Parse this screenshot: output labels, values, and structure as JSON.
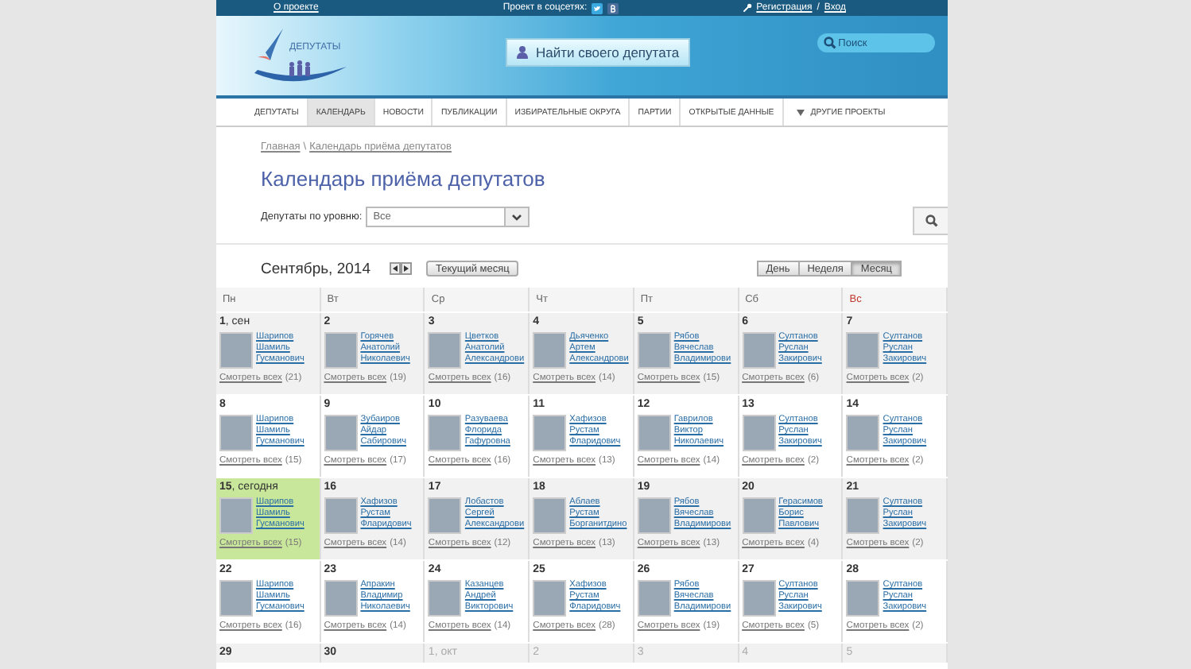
{
  "top_bar": {
    "about_link": "О проекте",
    "social_label": "Проект в соцсетях:",
    "register_link": "Регистрация",
    "separator": "/",
    "login_link": "Вход"
  },
  "header": {
    "logo_text": "ДЕПУТАТЫ",
    "find_button": "Найти своего депутата",
    "search": {
      "placeholder": "Поиск"
    }
  },
  "nav": [
    {
      "label": "ДЕПУТАТЫ",
      "selected": false
    },
    {
      "label": "КАЛЕНДАРЬ",
      "selected": true
    },
    {
      "label": "НОВОСТИ",
      "selected": false
    },
    {
      "label": "ПУБЛИКАЦИИ",
      "selected": false
    },
    {
      "label": "ИЗБИРАТЕЛЬНЫЕ ОКРУГА",
      "selected": false
    },
    {
      "label": "ПАРТИИ",
      "selected": false
    },
    {
      "label": "ОТКРЫТЫЕ ДАННЫЕ",
      "selected": false
    },
    {
      "label": "ДРУГИЕ ПРОЕКТЫ",
      "selected": false,
      "kind": "dropdown"
    }
  ],
  "breadcrumb": [
    {
      "label": "Главная"
    },
    {
      "label": "Календарь приёма депутатов"
    }
  ],
  "breadcrumb_separator": "\\",
  "title": "Календарь приёма депутатов",
  "filter": {
    "label": "Депутаты по уровню:",
    "value": "Все"
  },
  "calendar": {
    "month": "Сентябрь, 2014",
    "current_button": "Текущий месяц",
    "views": [
      {
        "label": "День",
        "selected": false
      },
      {
        "label": "Неделя",
        "selected": false
      },
      {
        "label": "Месяц",
        "selected": true
      }
    ],
    "weekdays": [
      {
        "label": "Пн",
        "weekend": false
      },
      {
        "label": "Вт",
        "weekend": false
      },
      {
        "label": "Ср",
        "weekend": false
      },
      {
        "label": "Чт",
        "weekend": false
      },
      {
        "label": "Пт",
        "weekend": false
      },
      {
        "label": "Сб",
        "weekend": false
      },
      {
        "label": "Вс",
        "weekend": true
      }
    ],
    "weeks": [
      [
        {
          "day": "1",
          "suffix": ", сен",
          "today": false,
          "other_month": false,
          "deputy": "Шарипов Шамиль Гусманович",
          "view_all": "Смотреть всех",
          "count": "(21)"
        },
        {
          "day": "2",
          "today": false,
          "other_month": false,
          "deputy": "Горячев Анатолий Николаевич",
          "view_all": "Смотреть всех",
          "count": "(19)"
        },
        {
          "day": "3",
          "today": false,
          "other_month": false,
          "deputy": "Цветков Анатолий Александрови",
          "view_all": "Смотреть всех",
          "count": "(16)"
        },
        {
          "day": "4",
          "today": false,
          "other_month": false,
          "deputy": "Дьяченко Артем Александрови",
          "view_all": "Смотреть всех",
          "count": "(14)"
        },
        {
          "day": "5",
          "today": false,
          "other_month": false,
          "deputy": "Рябов Вячеслав Владимирови",
          "view_all": "Смотреть всех",
          "count": "(15)"
        },
        {
          "day": "6",
          "today": false,
          "other_month": false,
          "deputy": "Султанов Руслан Закирович",
          "view_all": "Смотреть всех",
          "count": "(6)"
        },
        {
          "day": "7",
          "today": false,
          "other_month": false,
          "deputy": "Султанов Руслан Закирович",
          "view_all": "Смотреть всех",
          "count": "(2)"
        }
      ],
      [
        {
          "day": "8",
          "today": false,
          "other_month": false,
          "deputy": "Шарипов Шамиль Гусманович",
          "view_all": "Смотреть всех",
          "count": "(15)"
        },
        {
          "day": "9",
          "today": false,
          "other_month": false,
          "deputy": "Зубаиров Айдар Сабирович",
          "view_all": "Смотреть всех",
          "count": "(17)"
        },
        {
          "day": "10",
          "today": false,
          "other_month": false,
          "deputy": "Разуваева Флорида Гафуровна",
          "view_all": "Смотреть всех",
          "count": "(16)"
        },
        {
          "day": "11",
          "today": false,
          "other_month": false,
          "deputy": "Хафизов Рустам Фларидович",
          "view_all": "Смотреть всех",
          "count": "(13)"
        },
        {
          "day": "12",
          "today": false,
          "other_month": false,
          "deputy": "Гаврилов Виктор Николаевич",
          "view_all": "Смотреть всех",
          "count": "(14)"
        },
        {
          "day": "13",
          "today": false,
          "other_month": false,
          "deputy": "Султанов Руслан Закирович",
          "view_all": "Смотреть всех",
          "count": "(2)"
        },
        {
          "day": "14",
          "today": false,
          "other_month": false,
          "deputy": "Султанов Руслан Закирович",
          "view_all": "Смотреть всех",
          "count": "(2)"
        }
      ],
      [
        {
          "day": "15",
          "suffix": ", сегодня",
          "today": true,
          "other_month": false,
          "deputy": "Шарипов Шамиль Гусманович",
          "view_all": "Смотреть всех",
          "count": "(15)"
        },
        {
          "day": "16",
          "today": false,
          "other_month": false,
          "deputy": "Хафизов Рустам Фларидович",
          "view_all": "Смотреть всех",
          "count": "(14)"
        },
        {
          "day": "17",
          "today": false,
          "other_month": false,
          "deputy": "Лобастов Сергей Александрови",
          "view_all": "Смотреть всех",
          "count": "(12)"
        },
        {
          "day": "18",
          "today": false,
          "other_month": false,
          "deputy": "Аблаев Рустам Борганитдино",
          "view_all": "Смотреть всех",
          "count": "(13)"
        },
        {
          "day": "19",
          "today": false,
          "other_month": false,
          "deputy": "Рябов Вячеслав Владимирови",
          "view_all": "Смотреть всех",
          "count": "(13)"
        },
        {
          "day": "20",
          "today": false,
          "other_month": false,
          "deputy": "Герасимов Борис Павлович",
          "view_all": "Смотреть всех",
          "count": "(4)"
        },
        {
          "day": "21",
          "today": false,
          "other_month": false,
          "deputy": "Султанов Руслан Закирович",
          "view_all": "Смотреть всех",
          "count": "(2)"
        }
      ],
      [
        {
          "day": "22",
          "today": false,
          "other_month": false,
          "deputy": "Шарипов Шамиль Гусманович",
          "view_all": "Смотреть всех",
          "count": "(16)"
        },
        {
          "day": "23",
          "today": false,
          "other_month": false,
          "deputy": "Апракин Владимир Николаевич",
          "view_all": "Смотреть всех",
          "count": "(14)"
        },
        {
          "day": "24",
          "today": false,
          "other_month": false,
          "deputy": "Казанцев Андрей Викторович",
          "view_all": "Смотреть всех",
          "count": "(14)"
        },
        {
          "day": "25",
          "today": false,
          "other_month": false,
          "deputy": "Хафизов Рустам Фларидович",
          "view_all": "Смотреть всех",
          "count": "(28)"
        },
        {
          "day": "26",
          "today": false,
          "other_month": false,
          "deputy": "Рябов Вячеслав Владимирови",
          "view_all": "Смотреть всех",
          "count": "(19)"
        },
        {
          "day": "27",
          "today": false,
          "other_month": false,
          "deputy": "Султанов Руслан Закирович",
          "view_all": "Смотреть всех",
          "count": "(5)"
        },
        {
          "day": "28",
          "today": false,
          "other_month": false,
          "deputy": "Султанов Руслан Закирович",
          "view_all": "Смотреть всех",
          "count": "(2)"
        }
      ],
      [
        {
          "day": "29",
          "today": false,
          "other_month": false
        },
        {
          "day": "30",
          "today": false,
          "other_month": false
        },
        {
          "day": "1",
          "suffix": ", окт",
          "today": false,
          "other_month": true
        },
        {
          "day": "2",
          "today": false,
          "other_month": true
        },
        {
          "day": "3",
          "today": false,
          "other_month": true
        },
        {
          "day": "4",
          "today": false,
          "other_month": true
        },
        {
          "day": "5",
          "today": false,
          "other_month": true
        }
      ]
    ]
  }
}
